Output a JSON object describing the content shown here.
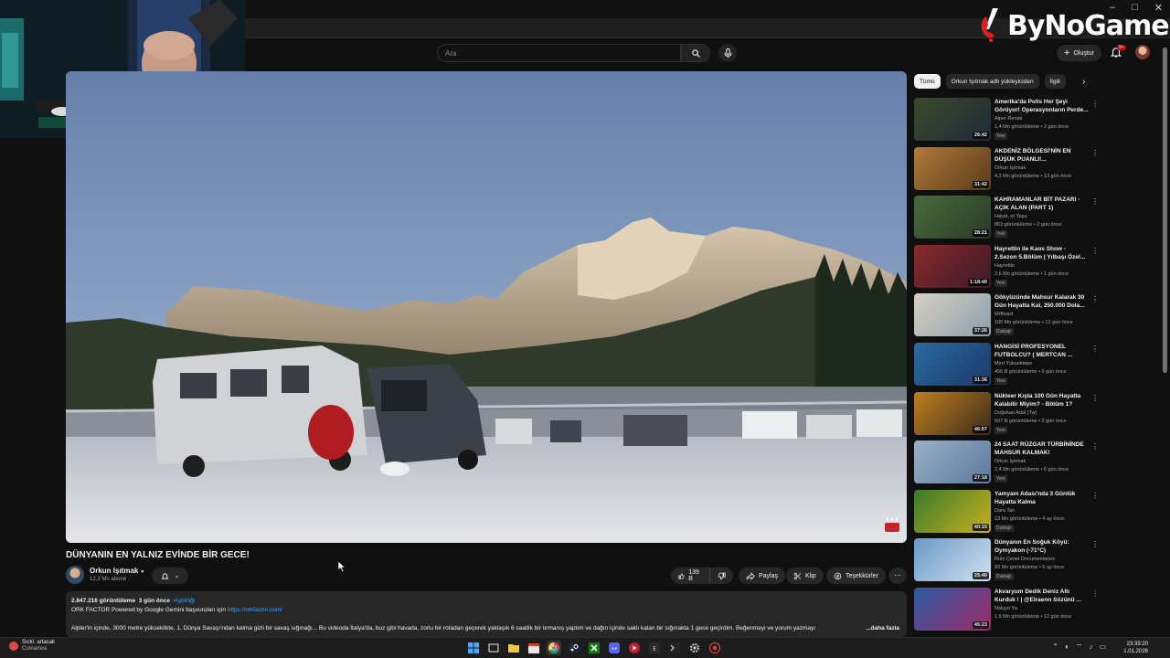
{
  "browser": {
    "window_controls": [
      "–",
      "□",
      "✕"
    ]
  },
  "header": {
    "search_placeholder": "Ara",
    "create_label": "Oluştur",
    "notification_count": "9+"
  },
  "watermark": {
    "brand": "ByNoGame"
  },
  "video": {
    "title": "DÜNYANIN EN YALNIZ EVİNDE BİR GECE!",
    "channel_name": "Orkun Işıtmak",
    "subscribers": "12,3 Mn abone",
    "likes": "139 B",
    "share_label": "Paylaş",
    "clip_label": "Klip",
    "thanks_label": "Teşekkürler",
    "more_label": "⋯"
  },
  "description": {
    "views": "2.847.216 görüntüleme",
    "age": "3 gün önce",
    "hashtag": "#işbirliği",
    "sponsor_line": "ORK FACTOR Powered by Google Gemini başvuruları için",
    "sponsor_link": "https://orkfactor.com/",
    "body": "Alpler'in içinde, 3000 metre yükseklikte, 1. Dünya Savaşı'ndan kalma gizli bir savaş sığınağı... Bu videoda İtalya'da, buz gibi havada, zorlu bir rotadan geçerek yaklaşık 6 saatlik bir tırmanış yaptım ve dağın içinde saklı kalan bir sığınakta 1 gece geçirdim. Beğenmeyi ve yorum yazmayı",
    "more": "...daha fazla"
  },
  "sidebar": {
    "chips": [
      "Tümü",
      "Orkun Işıtmak adlı yükleyiciden",
      "İlgili"
    ],
    "recommendations": [
      {
        "title": "Amerika'da Polis Her Şeyi Görüyor! Operasyonların Perde...",
        "channel": "Alper Rende",
        "meta": "1,4 Mn görüntüleme • 2 gün önce",
        "badge": "Yeni",
        "duration": "26:42",
        "c1": "#3a4a2a",
        "c2": "#1f2a3a"
      },
      {
        "title": "AKDENİZ BÖLGESİ'NİN EN DÜŞÜK PUANLI!...",
        "channel": "Orkun Işıtmak",
        "meta": "4,2 Mn görüntüleme • 13 gün önce",
        "badge": "",
        "duration": "31:42",
        "c1": "#b07a3a",
        "c2": "#5a3a1a"
      },
      {
        "title": "KAHRAMANLAR BİT PAZARI - AÇIK ALAN (PART 1)",
        "channel": "Hayat, et Yaşa",
        "meta": "863 görüntüleme • 2 gün önce",
        "badge": "Yeni",
        "duration": "28:21",
        "c1": "#4a6a3a",
        "c2": "#2a3a2a"
      },
      {
        "title": "Hayrettin ile Kaos Show - 2.Sezon 5.Bölüm | Yılbaşı Özel...",
        "channel": "Hayrettin",
        "meta": "2,6 Mn görüntüleme • 1 gün önce",
        "badge": "Yeni",
        "duration": "1:18:40",
        "c1": "#8a2a2a",
        "c2": "#3a1a2a"
      },
      {
        "title": "Gökyüzünde Mahsur Kalarak 30 Gün Hayatta Kal, 250.000 Dola...",
        "channel": "MrBeast",
        "meta": "105 Mn görüntüleme • 12 gün önce",
        "badge": "Dublajlı",
        "duration": "37:26",
        "c1": "#d8d0c0",
        "c2": "#8aa0b0"
      },
      {
        "title": "HANGİSİ PROFESYONEL FUTBOLCU? ( MERTCAN ...",
        "channel": "Mert Yüksektepe",
        "meta": "456 B görüntüleme • 6 gün önce",
        "badge": "Yeni",
        "duration": "31:36",
        "c1": "#2a6aa0",
        "c2": "#1a3a6a"
      },
      {
        "title": "Nükleer Kışta 100 Gün Hayatta Kalabilir Miyim? - Bölüm 1?",
        "channel": "Doğukan Adal (Tw)",
        "meta": "507 B görüntüleme • 2 gün önce",
        "badge": "Yeni",
        "duration": "46:57",
        "c1": "#c08020",
        "c2": "#3a2a1a"
      },
      {
        "title": "24 SAAT RÜZGAR TÜRBİNİNDE MAHSUR KALMAK!",
        "channel": "Orkun Işıtmak",
        "meta": "2,4 Mn görüntüleme • 6 gün önce",
        "badge": "Yeni",
        "duration": "27:18",
        "c1": "#9ab0c8",
        "c2": "#5a7a9a"
      },
      {
        "title": "Yamyam Adası'nda 3 Günlük Hayatta Kalma",
        "channel": "Dara Tan",
        "meta": "13 Mn görüntüleme • 4 ay önce",
        "badge": "Dublajlı",
        "duration": "40:15",
        "c1": "#3a7a2a",
        "c2": "#c8b020"
      },
      {
        "title": "Dünyanın En Soğuk Köyü: Oymyakon (-71°C)",
        "channel": "Ruhi Çenet Documentaries",
        "meta": "93 Mn görüntüleme • 6 ay önce",
        "badge": "Dublajlı",
        "duration": "25:40",
        "c1": "#6a9ac8",
        "c2": "#d0e0f0"
      },
      {
        "title": "Akvaryum Dedik Deniz Altı Kurduk ! | @Elraenn Sözünü ...",
        "channel": "Noluyo Ya",
        "meta": "1,6 Mn görüntüleme • 12 gün önce",
        "badge": "",
        "duration": "45:23",
        "c1": "#2a5aa0",
        "c2": "#a02a6a"
      }
    ]
  },
  "taskbar": {
    "weather_line1": "Sıckl. artacak",
    "weather_line2": "Cumartesi",
    "time": "23:39:20",
    "date": "1.01.2026"
  }
}
